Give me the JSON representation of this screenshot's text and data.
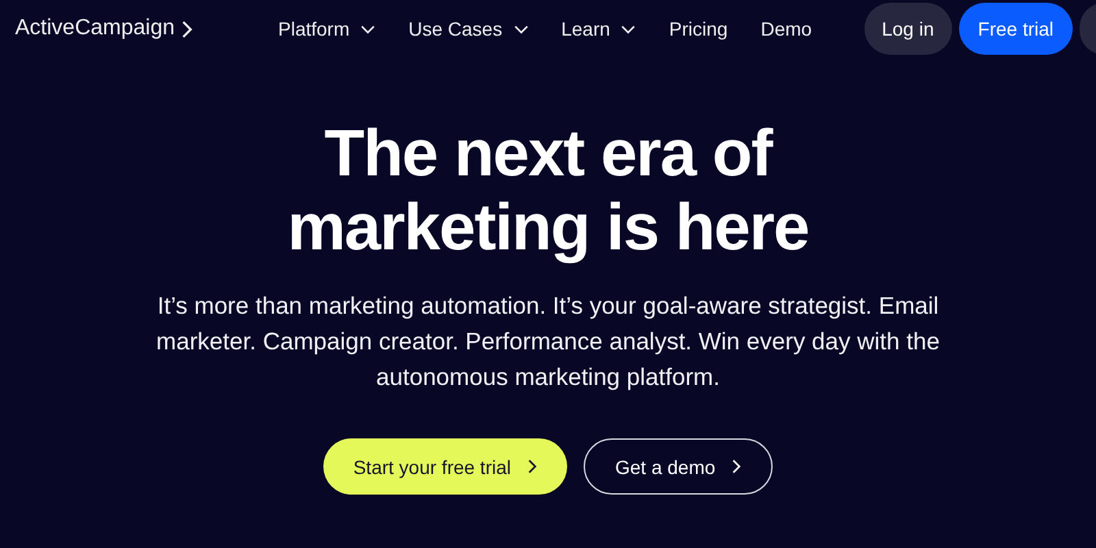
{
  "header": {
    "logo": "ActiveCampaign",
    "nav": [
      {
        "label": "Platform",
        "has_menu": true
      },
      {
        "label": "Use Cases",
        "has_menu": true
      },
      {
        "label": "Learn",
        "has_menu": true
      },
      {
        "label": "Pricing",
        "has_menu": false
      },
      {
        "label": "Demo",
        "has_menu": false
      }
    ],
    "actions": [
      {
        "label": "Log in",
        "kind": "secondary"
      },
      {
        "label": "Free trial",
        "kind": "primary"
      }
    ]
  },
  "hero": {
    "title": "The next era of marketing is here",
    "subtitle": "It’s more than marketing automation. It’s your goal-aware strategist. Email marketer. Campaign creator. Performance analyst. Win every day with the autonomous marketing platform.",
    "buttons": [
      {
        "label": "Start your free trial",
        "kind": "primary"
      },
      {
        "label": "Get a demo",
        "kind": "outline"
      }
    ]
  }
}
